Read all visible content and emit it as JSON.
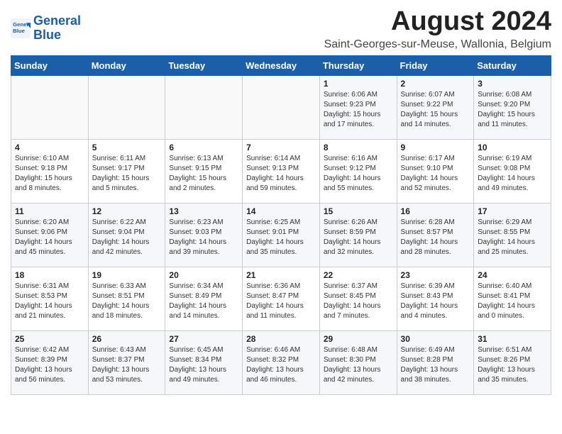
{
  "header": {
    "logo_line1": "General",
    "logo_line2": "Blue",
    "month_year": "August 2024",
    "location": "Saint-Georges-sur-Meuse, Wallonia, Belgium"
  },
  "weekdays": [
    "Sunday",
    "Monday",
    "Tuesday",
    "Wednesday",
    "Thursday",
    "Friday",
    "Saturday"
  ],
  "weeks": [
    [
      {
        "day": "",
        "info": ""
      },
      {
        "day": "",
        "info": ""
      },
      {
        "day": "",
        "info": ""
      },
      {
        "day": "",
        "info": ""
      },
      {
        "day": "1",
        "info": "Sunrise: 6:06 AM\nSunset: 9:23 PM\nDaylight: 15 hours\nand 17 minutes."
      },
      {
        "day": "2",
        "info": "Sunrise: 6:07 AM\nSunset: 9:22 PM\nDaylight: 15 hours\nand 14 minutes."
      },
      {
        "day": "3",
        "info": "Sunrise: 6:08 AM\nSunset: 9:20 PM\nDaylight: 15 hours\nand 11 minutes."
      }
    ],
    [
      {
        "day": "4",
        "info": "Sunrise: 6:10 AM\nSunset: 9:18 PM\nDaylight: 15 hours\nand 8 minutes."
      },
      {
        "day": "5",
        "info": "Sunrise: 6:11 AM\nSunset: 9:17 PM\nDaylight: 15 hours\nand 5 minutes."
      },
      {
        "day": "6",
        "info": "Sunrise: 6:13 AM\nSunset: 9:15 PM\nDaylight: 15 hours\nand 2 minutes."
      },
      {
        "day": "7",
        "info": "Sunrise: 6:14 AM\nSunset: 9:13 PM\nDaylight: 14 hours\nand 59 minutes."
      },
      {
        "day": "8",
        "info": "Sunrise: 6:16 AM\nSunset: 9:12 PM\nDaylight: 14 hours\nand 55 minutes."
      },
      {
        "day": "9",
        "info": "Sunrise: 6:17 AM\nSunset: 9:10 PM\nDaylight: 14 hours\nand 52 minutes."
      },
      {
        "day": "10",
        "info": "Sunrise: 6:19 AM\nSunset: 9:08 PM\nDaylight: 14 hours\nand 49 minutes."
      }
    ],
    [
      {
        "day": "11",
        "info": "Sunrise: 6:20 AM\nSunset: 9:06 PM\nDaylight: 14 hours\nand 45 minutes."
      },
      {
        "day": "12",
        "info": "Sunrise: 6:22 AM\nSunset: 9:04 PM\nDaylight: 14 hours\nand 42 minutes."
      },
      {
        "day": "13",
        "info": "Sunrise: 6:23 AM\nSunset: 9:03 PM\nDaylight: 14 hours\nand 39 minutes."
      },
      {
        "day": "14",
        "info": "Sunrise: 6:25 AM\nSunset: 9:01 PM\nDaylight: 14 hours\nand 35 minutes."
      },
      {
        "day": "15",
        "info": "Sunrise: 6:26 AM\nSunset: 8:59 PM\nDaylight: 14 hours\nand 32 minutes."
      },
      {
        "day": "16",
        "info": "Sunrise: 6:28 AM\nSunset: 8:57 PM\nDaylight: 14 hours\nand 28 minutes."
      },
      {
        "day": "17",
        "info": "Sunrise: 6:29 AM\nSunset: 8:55 PM\nDaylight: 14 hours\nand 25 minutes."
      }
    ],
    [
      {
        "day": "18",
        "info": "Sunrise: 6:31 AM\nSunset: 8:53 PM\nDaylight: 14 hours\nand 21 minutes."
      },
      {
        "day": "19",
        "info": "Sunrise: 6:33 AM\nSunset: 8:51 PM\nDaylight: 14 hours\nand 18 minutes."
      },
      {
        "day": "20",
        "info": "Sunrise: 6:34 AM\nSunset: 8:49 PM\nDaylight: 14 hours\nand 14 minutes."
      },
      {
        "day": "21",
        "info": "Sunrise: 6:36 AM\nSunset: 8:47 PM\nDaylight: 14 hours\nand 11 minutes."
      },
      {
        "day": "22",
        "info": "Sunrise: 6:37 AM\nSunset: 8:45 PM\nDaylight: 14 hours\nand 7 minutes."
      },
      {
        "day": "23",
        "info": "Sunrise: 6:39 AM\nSunset: 8:43 PM\nDaylight: 14 hours\nand 4 minutes."
      },
      {
        "day": "24",
        "info": "Sunrise: 6:40 AM\nSunset: 8:41 PM\nDaylight: 14 hours\nand 0 minutes."
      }
    ],
    [
      {
        "day": "25",
        "info": "Sunrise: 6:42 AM\nSunset: 8:39 PM\nDaylight: 13 hours\nand 56 minutes."
      },
      {
        "day": "26",
        "info": "Sunrise: 6:43 AM\nSunset: 8:37 PM\nDaylight: 13 hours\nand 53 minutes."
      },
      {
        "day": "27",
        "info": "Sunrise: 6:45 AM\nSunset: 8:34 PM\nDaylight: 13 hours\nand 49 minutes."
      },
      {
        "day": "28",
        "info": "Sunrise: 6:46 AM\nSunset: 8:32 PM\nDaylight: 13 hours\nand 46 minutes."
      },
      {
        "day": "29",
        "info": "Sunrise: 6:48 AM\nSunset: 8:30 PM\nDaylight: 13 hours\nand 42 minutes."
      },
      {
        "day": "30",
        "info": "Sunrise: 6:49 AM\nSunset: 8:28 PM\nDaylight: 13 hours\nand 38 minutes."
      },
      {
        "day": "31",
        "info": "Sunrise: 6:51 AM\nSunset: 8:26 PM\nDaylight: 13 hours\nand 35 minutes."
      }
    ]
  ]
}
